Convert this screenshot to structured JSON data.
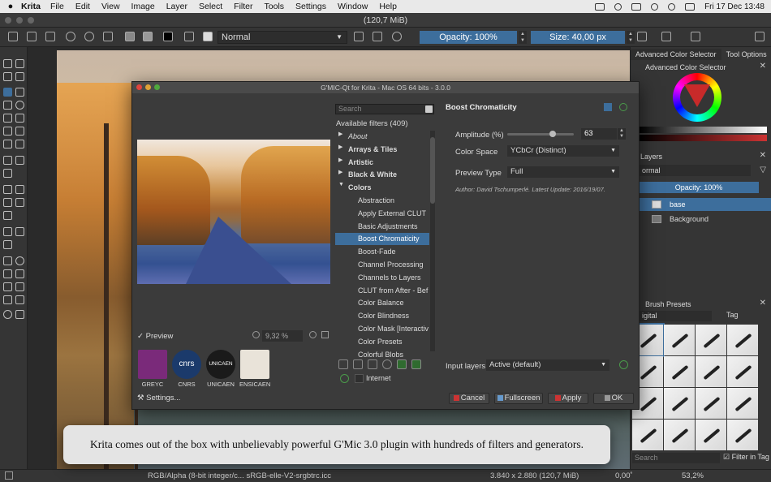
{
  "menubar": {
    "app_name": "Krita",
    "items": [
      "File",
      "Edit",
      "View",
      "Image",
      "Layer",
      "Select",
      "Filter",
      "Tools",
      "Settings",
      "Window",
      "Help"
    ],
    "clock": "Fri 17 Dec  13:48"
  },
  "window": {
    "title": "(120,7 MiB)"
  },
  "toolbar": {
    "blend_mode": "Normal",
    "opacity": "Opacity: 100%",
    "size": "Size: 40,00 px"
  },
  "dock": {
    "tabs": [
      "Advanced Color Selector",
      "Tool Options"
    ],
    "color_selector_title": "Advanced Color Selector",
    "layers_title": "Layers",
    "layer_mode": "ormal",
    "layer_opacity": "Opacity:  100%",
    "layers": [
      {
        "name": "base",
        "selected": true
      },
      {
        "name": "Background",
        "selected": false
      }
    ],
    "brush_presets_title": "Brush Presets",
    "preset_tag": "igital",
    "tag_label": "Tag",
    "search_placeholder": "Search",
    "filter_in_tag": "Filter in Tag"
  },
  "gmic": {
    "title": "G'MIC-Qt for Krita - Mac OS 64 bits - 3.0.0",
    "search_placeholder": "Search",
    "available_filters": "Available filters (409)",
    "tree": [
      {
        "label": "About",
        "kind": "cat-it"
      },
      {
        "label": "Arrays & Tiles",
        "kind": "cat"
      },
      {
        "label": "Artistic",
        "kind": "cat"
      },
      {
        "label": "Black & White",
        "kind": "cat"
      },
      {
        "label": "Colors",
        "kind": "cat-open"
      },
      {
        "label": "Abstraction",
        "kind": "item"
      },
      {
        "label": "Apply External CLUT",
        "kind": "item"
      },
      {
        "label": "Basic Adjustments",
        "kind": "item"
      },
      {
        "label": "Boost Chromaticity",
        "kind": "item-sel"
      },
      {
        "label": "Boost-Fade",
        "kind": "item"
      },
      {
        "label": "Channel Processing",
        "kind": "item"
      },
      {
        "label": "Channels to Layers",
        "kind": "item"
      },
      {
        "label": "CLUT from After - Bef",
        "kind": "item"
      },
      {
        "label": "Color Balance",
        "kind": "item"
      },
      {
        "label": "Color Blindness",
        "kind": "item"
      },
      {
        "label": "Color Mask [Interactiv",
        "kind": "item"
      },
      {
        "label": "Color Presets",
        "kind": "item"
      },
      {
        "label": "Colorful Blobs",
        "kind": "item"
      }
    ],
    "preview_label": "Preview",
    "zoom": "9,32 %",
    "logos": [
      "GREYC",
      "CNRS",
      "UNICAEN",
      "ENSICAEN"
    ],
    "cnrs_mark": "cnrs",
    "unicaen_mark": "UNICAEN",
    "settings_button": "Settings...",
    "internet_label": "Internet",
    "filter_name": "Boost Chromaticity",
    "params": {
      "amplitude_label": "Amplitude (%)",
      "amplitude_value": "63",
      "color_space_label": "Color Space",
      "color_space_value": "YCbCr (Distinct)",
      "preview_type_label": "Preview Type",
      "preview_type_value": "Full"
    },
    "author": "Author: David Tschumperlé.        Latest Update: 2016/19/07.",
    "input_layers_label": "Input layers",
    "input_layers_value": "Active (default)",
    "buttons": {
      "cancel": "Cancel",
      "fullscreen": "Fullscreen",
      "apply": "Apply",
      "ok": "OK"
    }
  },
  "statusbar": {
    "color_info": "RGB/Alpha (8-bit integer/c... sRGB-elle-V2-srgbtrc.icc",
    "dimensions": "3.840 x 2.880 (120,7 MiB)",
    "rotation": "0,00˚",
    "zoom": "53,2%"
  },
  "caption": "Krita comes out of the box with unbelievably powerful G'Mic 3.0 plugin with hundreds of filters and generators.",
  "colors": {
    "accent": "#3d6e9c",
    "panel": "#353535",
    "dialog": "#3b3b3b"
  }
}
